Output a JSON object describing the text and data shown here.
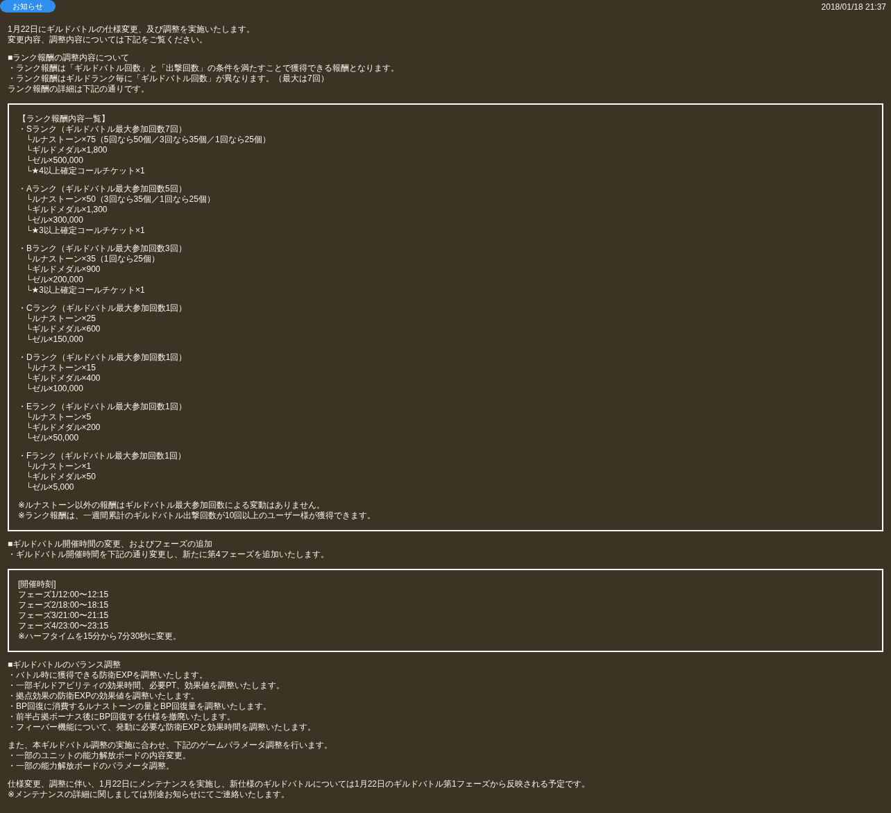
{
  "header": {
    "badge": "お知らせ",
    "date": "2018/01/18 21:37"
  },
  "blocks": [
    {
      "kind": "paragraph",
      "lines": [
        "1月22日にギルドバトルの仕様変更、及び調整を実施いたします。",
        "変更内容、調整内容については下記をご覧ください。"
      ]
    },
    {
      "kind": "paragraph",
      "lines": [
        "■ランク報酬の調整内容について",
        "・ランク報酬は「ギルドバトル回数」と「出撃回数」の条件を満たすことで獲得できる報酬となります。",
        "・ランク報酬はギルドランク毎に「ギルドバトル回数」が異なります。（最大は7回）",
        "ランク報酬の詳細は下記の通りです。"
      ]
    },
    {
      "kind": "box",
      "groups": [
        [
          {
            "text": "【ランク報酬内容一覧】"
          },
          {
            "text": "・Sランク（ギルドバトル最大参加回数7回）",
            "children": [
              {
                "text": "└ルナストーン×75（5回なら50個／3回なら35個／1回なら25個）"
              },
              {
                "text": "└ギルドメダル×1,800"
              },
              {
                "text": "└ゼル×500,000"
              },
              {
                "text": "└★4以上確定コールチケット×1"
              }
            ]
          }
        ],
        [
          {
            "text": "・Aランク（ギルドバトル最大参加回数5回）",
            "children": [
              {
                "text": "└ルナストーン×50（3回なら35個／1回なら25個）"
              },
              {
                "text": "└ギルドメダル×1,300"
              },
              {
                "text": "└ゼル×300,000"
              },
              {
                "text": "└★3以上確定コールチケット×1"
              }
            ]
          }
        ],
        [
          {
            "text": "・Bランク（ギルドバトル最大参加回数3回）",
            "children": [
              {
                "text": "└ルナストーン×35（1回なら25個）"
              },
              {
                "text": "└ギルドメダル×900"
              },
              {
                "text": "└ゼル×200,000"
              },
              {
                "text": "└★3以上確定コールチケット×1"
              }
            ]
          }
        ],
        [
          {
            "text": "・Cランク（ギルドバトル最大参加回数1回）",
            "children": [
              {
                "text": "└ルナストーン×25"
              },
              {
                "text": "└ギルドメダル×600"
              },
              {
                "text": "└ゼル×150,000"
              }
            ]
          }
        ],
        [
          {
            "text": "・Dランク（ギルドバトル最大参加回数1回）",
            "children": [
              {
                "text": "└ルナストーン×15"
              },
              {
                "text": "└ギルドメダル×400"
              },
              {
                "text": "└ゼル×100,000"
              }
            ]
          }
        ],
        [
          {
            "text": "・Eランク（ギルドバトル最大参加回数1回）",
            "children": [
              {
                "text": "└ルナストーン×5"
              },
              {
                "text": "└ギルドメダル×200"
              },
              {
                "text": "└ゼル×50,000"
              }
            ]
          }
        ],
        [
          {
            "text": "・Fランク（ギルドバトル最大参加回数1回）",
            "children": [
              {
                "text": "└ルナストーン×1"
              },
              {
                "text": "└ギルドメダル×50"
              },
              {
                "text": "└ゼル×5,000"
              }
            ]
          }
        ],
        [
          {
            "text": "※ルナストーン以外の報酬はギルドバトル最大参加回数による変動はありません。"
          },
          {
            "text": "※ランク報酬は、一週間累計のギルドバトル出撃回数が10回以上のユーザー様が獲得できます。"
          }
        ]
      ]
    },
    {
      "kind": "paragraph",
      "lines": [
        "■ギルドバトル開催時間の変更、およびフェーズの追加",
        "・ギルドバトル開催時間を下記の通り変更し、新たに第4フェーズを追加いたします。"
      ]
    },
    {
      "kind": "box",
      "groups": [
        [
          {
            "text": "[開催時刻]"
          },
          {
            "text": "フェーズ1/12:00〜12:15"
          },
          {
            "text": "フェーズ2/18:00〜18:15"
          },
          {
            "text": "フェーズ3/21:00〜21:15"
          },
          {
            "text": "フェーズ4/23:00〜23:15"
          },
          {
            "text": "※ハーフタイムを15分から7分30秒に変更。"
          }
        ]
      ]
    },
    {
      "kind": "paragraph",
      "lines": [
        "■ギルドバトルのバランス調整",
        "・バトル時に獲得できる防衛EXPを調整いたします。",
        "・一部ギルドアビリティの効果時間、必要PT、効果値を調整いたします。",
        "・拠点効果の防衛EXPの効果値を調整いたします。",
        "・BP回復に消費するルナストーンの量とBP回復量を調整いたします。",
        "・前半占拠ボーナス後にBP回復する仕様を撤廃いたします。",
        "・フィーバー機能について、発動に必要な防衛EXPと効果時間を調整いたします。"
      ]
    },
    {
      "kind": "paragraph",
      "lines": [
        "また、本ギルドバトル調整の実施に合わせ、下記のゲームパラメータ調整を行います。",
        "・一部のユニットの能力解放ボードの内容変更。",
        "・一部の能力解放ボードのパラメータ調整。"
      ]
    },
    {
      "kind": "paragraph",
      "lines": [
        "仕様変更、調整に伴い、1月22日にメンテナンスを実施し、新仕様のギルドバトルについては1月22日のギルドバトル第1フェーズから反映される予定です。",
        "※メンテナンスの詳細に関しましては別途お知らせにてご連絡いたします。"
      ]
    }
  ]
}
